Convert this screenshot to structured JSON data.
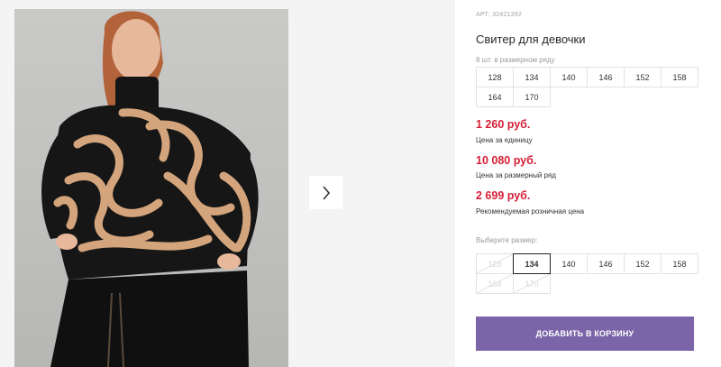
{
  "product": {
    "article": "АРТ: 32421392",
    "title": "Свитер для девочки"
  },
  "pack": {
    "hint": "8 шт. в размерном ряду",
    "sizes": [
      "128",
      "134",
      "140",
      "146",
      "152",
      "158",
      "164",
      "170"
    ]
  },
  "prices": {
    "unit_price": "1 260 руб.",
    "unit_label": "Цена за единицу",
    "row_price": "10 080 руб.",
    "row_label": "Цена за размерный ряд",
    "retail_price": "2 699 руб.",
    "retail_label": "Рекомендуемая розничная цена"
  },
  "select": {
    "hint": "Выберите размер:",
    "sizes": [
      "128",
      "134",
      "140",
      "146",
      "152",
      "158",
      "164",
      "170"
    ],
    "selected": "134",
    "disabled": [
      "128",
      "164",
      "170"
    ]
  },
  "cart": {
    "label": "ДОБАВИТЬ В КОРЗИНУ"
  },
  "colors": {
    "price": "#d51e36",
    "button": "#7b65a8"
  },
  "icons": {
    "next": "chevron-right-icon"
  }
}
